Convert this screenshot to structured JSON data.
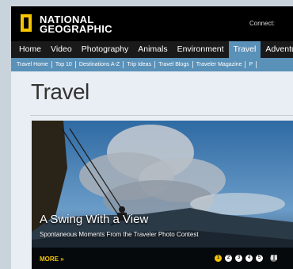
{
  "header": {
    "logo_line1": "NATIONAL",
    "logo_line2": "GEOGRAPHIC",
    "connect_label": "Connect:"
  },
  "main_nav": {
    "items": [
      {
        "label": "Home"
      },
      {
        "label": "Video"
      },
      {
        "label": "Photography"
      },
      {
        "label": "Animals"
      },
      {
        "label": "Environment"
      },
      {
        "label": "Travel",
        "active": true
      },
      {
        "label": "Adventure"
      }
    ]
  },
  "sub_nav": {
    "items": [
      {
        "label": "Travel Home"
      },
      {
        "label": "Top 10"
      },
      {
        "label": "Destinations A-Z"
      },
      {
        "label": "Trip Ideas"
      },
      {
        "label": "Travel Blogs"
      },
      {
        "label": "Traveler Magazine"
      },
      {
        "label": "P"
      }
    ]
  },
  "page": {
    "title": "Travel"
  },
  "hero": {
    "title": "A Swing With a View",
    "subtitle": "Spontaneous Moments From the Traveler Photo Contest",
    "more_label": "MORE »",
    "slides": [
      "1",
      "2",
      "3",
      "4",
      "5"
    ],
    "active_slide": 1,
    "pause_icon": "pause-icon"
  },
  "colors": {
    "brand_yellow": "#f5c400",
    "nav_active": "#5a91b8",
    "topbar": "#000000"
  }
}
